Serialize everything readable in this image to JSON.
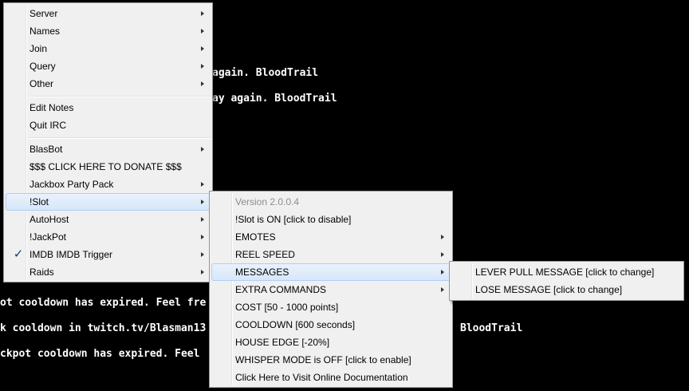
{
  "console": {
    "line1": "again. BloodTrail",
    "line2": "ay again. BloodTrail",
    "line3": "ot cooldown has expired. Feel fre",
    "line4a": "k cooldown in twitch.tv/Blasman13",
    "line4b": "BloodTrail",
    "line5": "ckpot cooldown has expired. Feel"
  },
  "main_menu": {
    "items": [
      {
        "label": "Server"
      },
      {
        "label": "Names"
      },
      {
        "label": "Join"
      },
      {
        "label": "Query"
      },
      {
        "label": "Other"
      },
      {
        "label": "Edit Notes"
      },
      {
        "label": "Quit IRC"
      },
      {
        "label": "BlasBot"
      },
      {
        "label": "$$$ CLICK HERE TO DONATE $$$"
      },
      {
        "label": "Jackbox Party Pack"
      },
      {
        "label": "!Slot"
      },
      {
        "label": "AutoHost"
      },
      {
        "label": "!JackPot"
      },
      {
        "label": "IMDB IMDB Trigger",
        "checked": true
      },
      {
        "label": "Raids"
      }
    ],
    "check_glyph": "✓"
  },
  "slot_menu": {
    "items": [
      {
        "label": "Version 2.0.0.4",
        "disabled": true
      },
      {
        "label": "!Slot is ON [click to disable]"
      },
      {
        "label": "EMOTES"
      },
      {
        "label": "REEL SPEED"
      },
      {
        "label": "MESSAGES"
      },
      {
        "label": "EXTRA COMMANDS"
      },
      {
        "label": "COST [50 - 1000 points]"
      },
      {
        "label": "COOLDOWN [600 seconds]"
      },
      {
        "label": "HOUSE EDGE [-20%]"
      },
      {
        "label": "WHISPER MODE is OFF [click to enable]"
      },
      {
        "label": "Click Here to Visit Online Documentation"
      }
    ]
  },
  "messages_menu": {
    "items": [
      {
        "label": "LEVER PULL MESSAGE [click to change]"
      },
      {
        "label": "LOSE MESSAGE [click to change]"
      }
    ]
  },
  "colors": {
    "background": "#000000",
    "menu_bg": "#f0f0f0",
    "highlight": "#d7e6f9",
    "disabled_text": "#8d8d8d"
  }
}
